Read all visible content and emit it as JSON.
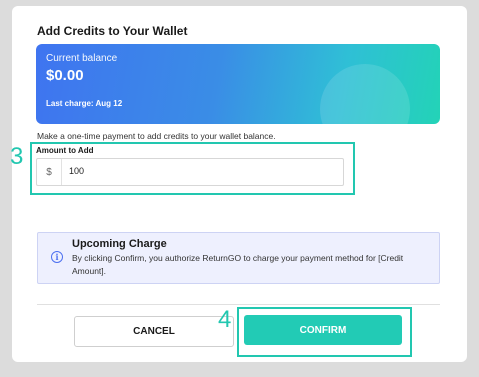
{
  "wallet": {
    "title": "Add Credits to Your Wallet",
    "balance_label": "Current balance",
    "balance_value": "$0.00",
    "last_charge": "Last charge: Aug 12"
  },
  "description": "Make a one-time payment to add credits to your wallet balance.",
  "amount": {
    "step_number": "3",
    "label": "Amount to Add",
    "currency_prefix": "$",
    "value": "100"
  },
  "info": {
    "icon": "info-icon",
    "title": "Upcoming Charge",
    "text": "By clicking Confirm, you authorize ReturnGO to charge your payment method for [Credit Amount]."
  },
  "actions": {
    "step_number": "4",
    "cancel_label": "CANCEL",
    "confirm_label": "CONFIRM"
  },
  "colors": {
    "accent": "#22cbb5",
    "card_gradient_start": "#3f74f0",
    "card_gradient_end": "#23d3b7",
    "info_bg": "#eef0fe"
  }
}
